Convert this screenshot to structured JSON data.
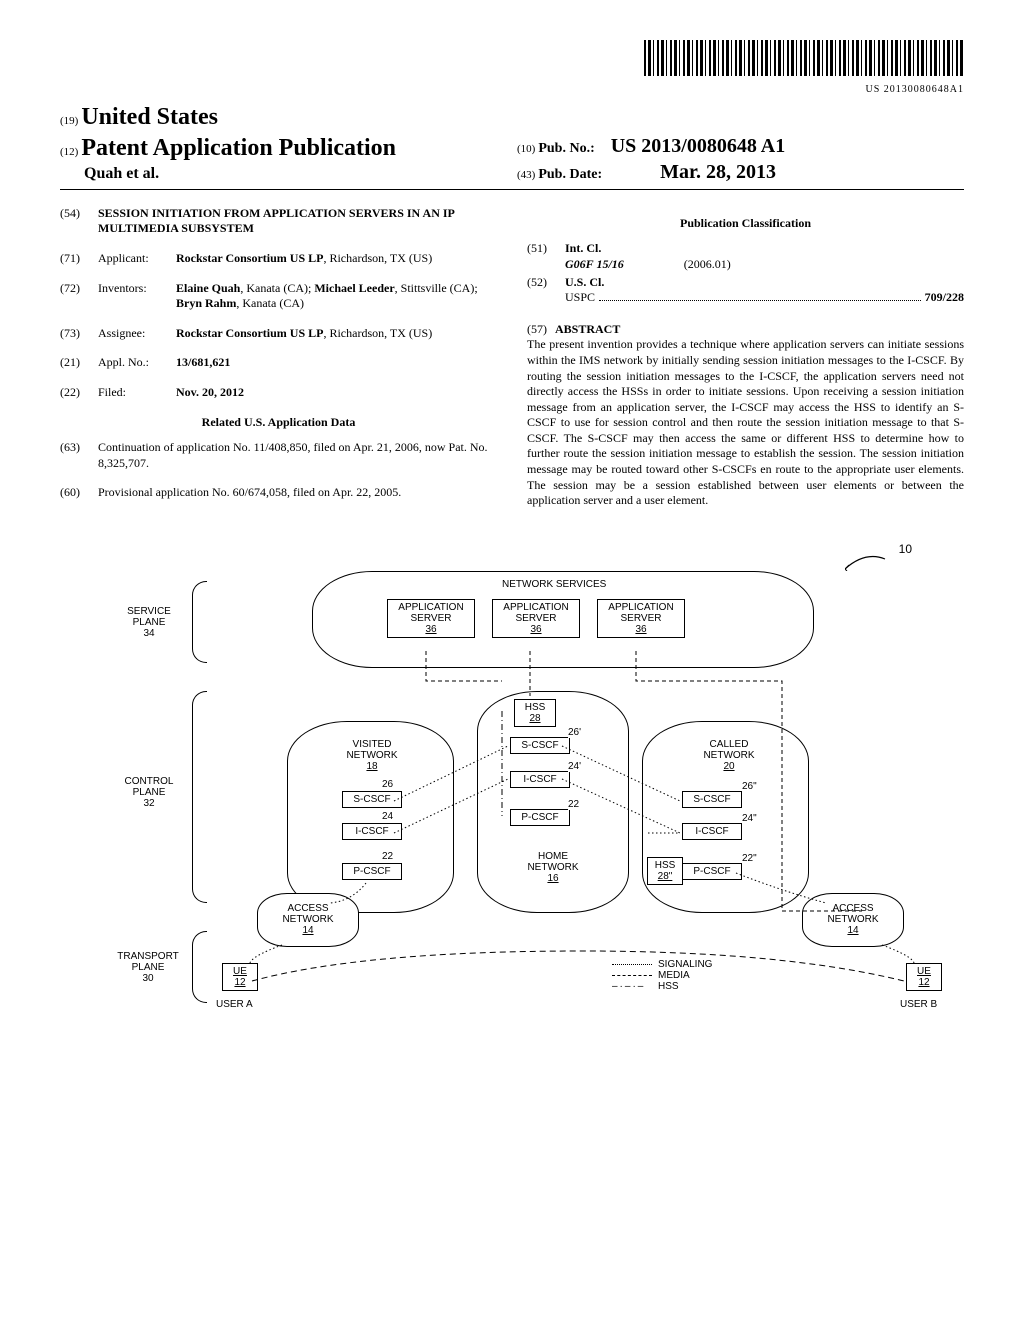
{
  "barcode_text": "US 20130080648A1",
  "header": {
    "num19": "(19)",
    "country": "United States",
    "num12": "(12)",
    "pub_title": "Patent Application Publication",
    "authors": "Quah et al.",
    "num10": "(10)",
    "pub_no_label": "Pub. No.:",
    "pub_no": "US 2013/0080648 A1",
    "num43": "(43)",
    "pub_date_label": "Pub. Date:",
    "pub_date": "Mar. 28, 2013"
  },
  "left": {
    "s54_num": "(54)",
    "s54_title": "SESSION INITIATION FROM APPLICATION SERVERS IN AN IP MULTIMEDIA SUBSYSTEM",
    "s71_num": "(71)",
    "s71_label": "Applicant:",
    "s71_value_prefix": "Rockstar Consortium US LP",
    "s71_value_suffix": ", Richardson, TX (US)",
    "s72_num": "(72)",
    "s72_label": "Inventors:",
    "s72_v1": "Elaine Quah",
    "s72_v1s": ", Kanata (CA); ",
    "s72_v2": "Michael Leeder",
    "s72_v2s": ", Stittsville (CA); ",
    "s72_v3": "Bryn Rahm",
    "s72_v3s": ", Kanata (CA)",
    "s73_num": "(73)",
    "s73_label": "Assignee:",
    "s73_value_prefix": "Rockstar Consortium US LP",
    "s73_value_suffix": ", Richardson, TX (US)",
    "s21_num": "(21)",
    "s21_label": "Appl. No.:",
    "s21_value": "13/681,621",
    "s22_num": "(22)",
    "s22_label": "Filed:",
    "s22_value": "Nov. 20, 2012",
    "related_heading": "Related U.S. Application Data",
    "s63_num": "(63)",
    "s63_value": "Continuation of application No. 11/408,850, filed on Apr. 21, 2006, now Pat. No. 8,325,707.",
    "s60_num": "(60)",
    "s60_value": "Provisional application No. 60/674,058, filed on Apr. 22, 2005."
  },
  "right": {
    "classification_heading": "Publication Classification",
    "s51_num": "(51)",
    "s51_label": "Int. Cl.",
    "s51_code": "G06F 15/16",
    "s51_year": "(2006.01)",
    "s52_num": "(52)",
    "s52_label": "U.S. Cl.",
    "uspc_label": "USPC",
    "uspc_value": "709/228",
    "s57_num": "(57)",
    "abstract_heading": "ABSTRACT",
    "abstract": "The present invention provides a technique where application servers can initiate sessions within the IMS network by initially sending session initiation messages to the I-CSCF. By routing the session initiation messages to the I-CSCF, the application servers need not directly access the HSSs in order to initiate sessions. Upon receiving a session initiation message from an application server, the I-CSCF may access the HSS to identify an S-CSCF to use for session control and then route the session initiation message to that S-CSCF. The S-CSCF may then access the same or different HSS to determine how to further route the session initiation message to establish the session. The session initiation message may be routed toward other S-CSCFs en route to the appropriate user elements. The session may be a session established between user elements or between the application server and a user element."
  },
  "figure": {
    "ref10": "10",
    "service_plane": "SERVICE PLANE",
    "service_plane_num": "34",
    "control_plane": "CONTROL PLANE",
    "control_plane_num": "32",
    "transport_plane": "TRANSPORT PLANE",
    "transport_plane_num": "30",
    "network_services": "NETWORK SERVICES",
    "app_server": "APPLICATION SERVER",
    "app_server_num": "36",
    "hss": "HSS",
    "hss_num": "28",
    "hss2_num": "28\"",
    "visited_network": "VISITED NETWORK",
    "visited_num": "18",
    "home_network": "HOME NETWORK",
    "home_num": "16",
    "called_network": "CALLED NETWORK",
    "called_num": "20",
    "scscf": "S-CSCF",
    "icscf": "I-CSCF",
    "pcscf": "P-CSCF",
    "r26": "26",
    "r26p": "26'",
    "r26pp": "26\"",
    "r24": "24",
    "r24p": "24'",
    "r24pp": "24\"",
    "r22": "22",
    "r22pp": "22\"",
    "access_network": "ACCESS NETWORK",
    "access_num": "14",
    "ue": "UE",
    "ue_num": "12",
    "user_a": "USER A",
    "user_b": "USER B",
    "legend_signaling": "SIGNALING",
    "legend_media": "MEDIA",
    "legend_hss": "HSS"
  }
}
